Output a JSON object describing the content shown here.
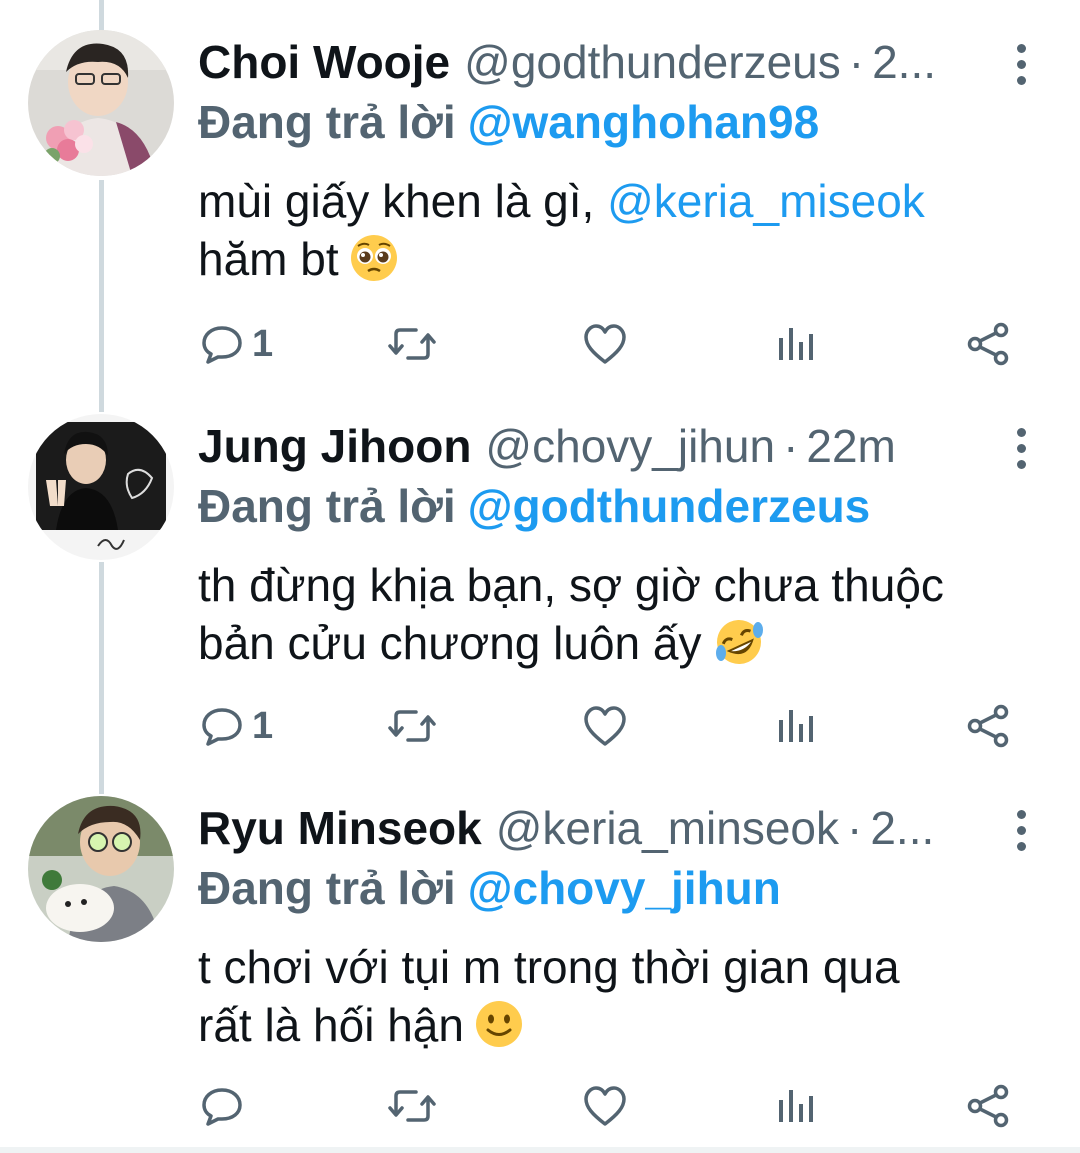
{
  "tweets": [
    {
      "name": "Choi Wooje",
      "handle": "@godthunderzeus",
      "dot": "·",
      "time": "2...",
      "reply_prefix": "Đang trả lời",
      "reply_to": "@wanghohan98",
      "body_parts": [
        "mùi giấy khen là gì, ",
        "@keria_miseok",
        "hăm bt"
      ],
      "emoji": "pleading-face",
      "reply_count": "1",
      "avatar": "avatar-choi-wooje"
    },
    {
      "name": "Jung Jihoon",
      "handle": "@chovy_jihun",
      "dot": "·",
      "time": "22m",
      "reply_prefix": "Đang trả lời",
      "reply_to": "@godthunderzeus",
      "body_line1": "th đừng khịa bạn, sợ giờ chưa thuộc",
      "body_line2": "bản cửu chương luôn ấy",
      "emoji": "rolling-on-floor-laughing",
      "reply_count": "1",
      "avatar": "avatar-jung-jihoon"
    },
    {
      "name": "Ryu Minseok",
      "handle": "@keria_minseok",
      "dot": "·",
      "time": "2...",
      "reply_prefix": "Đang trả lời",
      "reply_to": "@chovy_jihun",
      "body_line1": "t chơi với tụi m trong thời gian qua",
      "body_line2": "rất là hối hận",
      "emoji": "slightly-smiling-face",
      "reply_count": "",
      "avatar": "avatar-ryu-minseok"
    }
  ],
  "icons": {
    "reply": "reply-icon",
    "retweet": "retweet-icon",
    "like": "like-icon",
    "analytics": "analytics-icon",
    "share": "share-icon",
    "more": "more-icon"
  },
  "colors": {
    "text": "#0f1419",
    "secondary": "#536471",
    "link": "#1d9bf0",
    "thread_line": "#cfd9de"
  }
}
